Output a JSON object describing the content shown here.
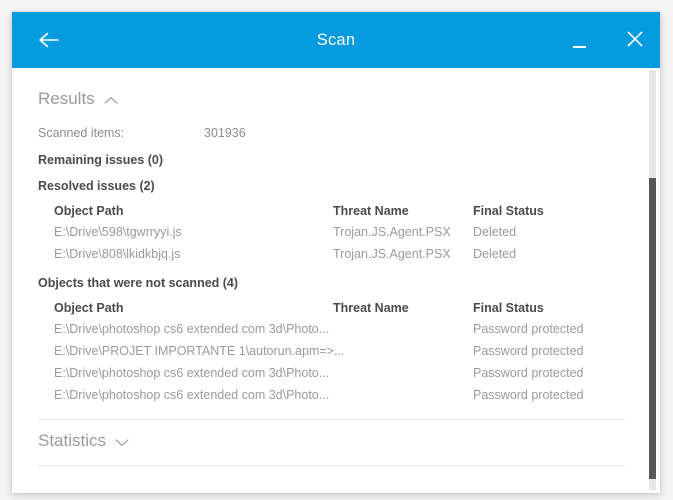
{
  "window": {
    "title": "Scan",
    "accent_color": "#039ADE",
    "back_icon": "arrow-left-icon",
    "minimize_label": "",
    "close_label": ""
  },
  "results": {
    "heading": "Results",
    "toggle_icon": "chevron-up-icon",
    "scanned_items": {
      "label": "Scanned items:",
      "value": "301936"
    },
    "remaining_issues_heading": "Remaining issues (0)",
    "resolved_issues_heading": "Resolved issues (2)",
    "resolved_table": {
      "columns": [
        "Object Path",
        "Threat Name",
        "Final Status"
      ],
      "rows": [
        {
          "path": "E:\\Drive\\598\\tgwrryyi.js",
          "threat": "Trojan.JS.Agent.PSX",
          "status": "Deleted"
        },
        {
          "path": "E:\\Drive\\808\\lkidkbjq.js",
          "threat": "Trojan.JS.Agent.PSX",
          "status": "Deleted"
        }
      ]
    },
    "not_scanned_heading": "Objects that were not scanned (4)",
    "not_scanned_table": {
      "columns": [
        "Object Path",
        "Threat Name",
        "Final Status"
      ],
      "rows": [
        {
          "path": "E:\\Drive\\photoshop cs6 extended com 3d\\Photo...",
          "threat": "",
          "status": "Password protected"
        },
        {
          "path": "E:\\Drive\\PROJET IMPORTANTE 1\\autorun.apm=>...",
          "threat": "",
          "status": "Password protected"
        },
        {
          "path": "E:\\Drive\\photoshop cs6 extended com 3d\\Photo...",
          "threat": "",
          "status": "Password protected"
        },
        {
          "path": "E:\\Drive\\photoshop cs6 extended com 3d\\Photo...",
          "threat": "",
          "status": "Password protected"
        }
      ]
    }
  },
  "statistics": {
    "heading": "Statistics",
    "toggle_icon": "chevron-down-icon"
  }
}
